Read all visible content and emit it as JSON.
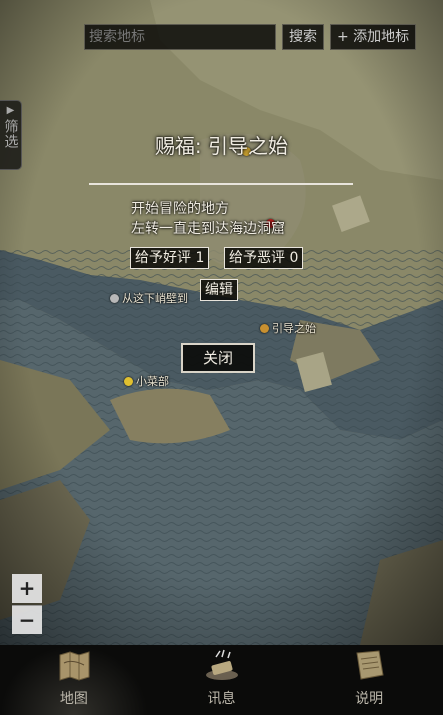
{
  "search": {
    "placeholder": "搜索地标",
    "button": "搜索",
    "add_button": "+ 添加地标"
  },
  "filter_tab": {
    "arrow": "▶",
    "label": "筛选"
  },
  "map_markers": [
    {
      "label": "",
      "color": "#c8a030"
    },
    {
      "label": "",
      "color": "#c02020"
    },
    {
      "label": "从这下峭壁到",
      "color": "#b8b8b8"
    },
    {
      "label": "引导之始",
      "color": "#c89030"
    },
    {
      "label": "小菜部",
      "color": "#e0c030"
    }
  ],
  "popup": {
    "title": "赐福: 引导之始",
    "line1": "开始冒险的地方",
    "line2": "左转一直走到达海边洞窟",
    "like_button": "给予好评 1",
    "dislike_button": "给予恶评 0",
    "edit_button": "编辑",
    "close_button": "关闭"
  },
  "zoom": {
    "in": "+",
    "out": "−"
  },
  "nav": [
    {
      "label": "地图",
      "icon": "map-scroll-icon",
      "active": true
    },
    {
      "label": "讯息",
      "icon": "message-icon",
      "active": false
    },
    {
      "label": "说明",
      "icon": "guide-icon",
      "active": false
    }
  ],
  "colors": {
    "land": "#8a8868",
    "sea": "#4a5a62",
    "nav_bg": "#0b0b0a"
  }
}
